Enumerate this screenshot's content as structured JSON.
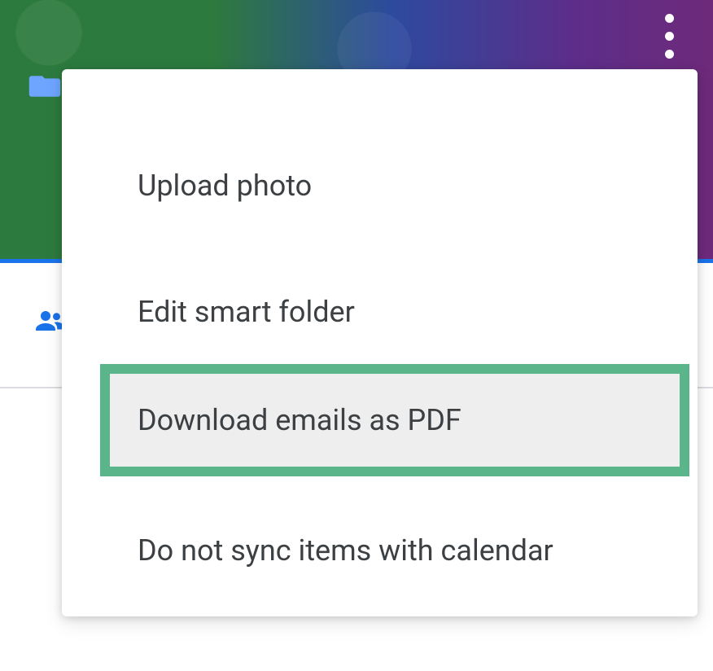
{
  "menu": {
    "items": [
      {
        "label": "Upload photo"
      },
      {
        "label": "Edit smart folder"
      },
      {
        "label": "Download emails as PDF",
        "highlighted": true
      },
      {
        "label": "Do not sync items with calendar"
      }
    ]
  },
  "icons": {
    "folder": "folder-icon",
    "people": "people-icon",
    "more": "more-vert-icon"
  },
  "colors": {
    "highlight_border": "#5ab58b",
    "highlight_bg": "#eeeeee",
    "accent": "#1a73e8",
    "text": "#3c4043"
  }
}
